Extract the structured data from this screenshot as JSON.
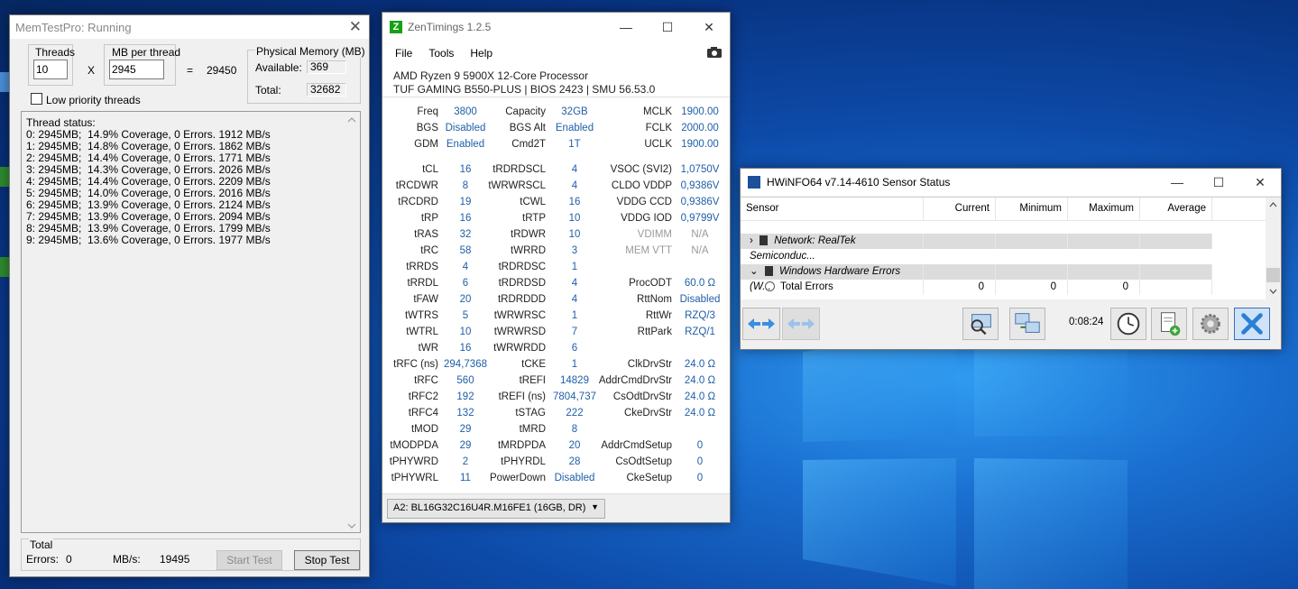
{
  "memtest": {
    "title": "MemTestPro: Running",
    "threads_label": "Threads",
    "threads_value": "10",
    "x_sign": "X",
    "mb_label": "MB per thread",
    "mb_value": "2945",
    "eq_sign": "=",
    "total_mb": "29450",
    "phys_label": "Physical Memory (MB)",
    "available_label": "Available:",
    "available_value": "369",
    "total_label": "Total:",
    "total_value": "32682",
    "low_priority_label": "Low priority threads",
    "status_lines": [
      "Thread status:",
      "0: 2945MB;  14.9% Coverage, 0 Errors. 1912 MB/s",
      "1: 2945MB;  14.8% Coverage, 0 Errors. 1862 MB/s",
      "2: 2945MB;  14.4% Coverage, 0 Errors. 1771 MB/s",
      "3: 2945MB;  14.3% Coverage, 0 Errors. 2026 MB/s",
      "4: 2945MB;  14.4% Coverage, 0 Errors. 2209 MB/s",
      "5: 2945MB;  14.0% Coverage, 0 Errors. 2016 MB/s",
      "6: 2945MB;  13.9% Coverage, 0 Errors. 2124 MB/s",
      "7: 2945MB;  13.9% Coverage, 0 Errors. 2094 MB/s",
      "8: 2945MB;  13.9% Coverage, 0 Errors. 1799 MB/s",
      "9: 2945MB;  13.6% Coverage, 0 Errors. 1977 MB/s"
    ],
    "total_group_label": "Total",
    "errors_label": "Errors:",
    "errors_value": "0",
    "mbs_label": "MB/s:",
    "mbs_value": "19495",
    "start_label": "Start Test",
    "stop_label": "Stop Test"
  },
  "zen": {
    "title": "ZenTimings 1.2.5",
    "logo_letter": "Z",
    "menu": [
      "File",
      "Tools",
      "Help"
    ],
    "cpu": "AMD Ryzen 9 5900X 12-Core Processor",
    "board": "TUF GAMING B550-PLUS | BIOS 2423 | SMU 56.53.0",
    "rows": [
      [
        "Freq",
        "3800",
        "Capacity",
        "32GB",
        "MCLK",
        "1900.00"
      ],
      [
        "BGS",
        "Disabled",
        "BGS Alt",
        "Enabled",
        "FCLK",
        "2000.00"
      ],
      [
        "GDM",
        "Enabled",
        "Cmd2T",
        "1T",
        "UCLK",
        "1900.00"
      ],
      null,
      [
        "tCL",
        "16",
        "tRDRDSCL",
        "4",
        "VSOC (SVI2)",
        "1,0750V"
      ],
      [
        "tRCDWR",
        "8",
        "tWRWRSCL",
        "4",
        "CLDO VDDP",
        "0,9386V"
      ],
      [
        "tRCDRD",
        "19",
        "tCWL",
        "16",
        "VDDG CCD",
        "0,9386V"
      ],
      [
        "tRP",
        "16",
        "tRTP",
        "10",
        "VDDG IOD",
        "0,9799V"
      ],
      [
        "tRAS",
        "32",
        "tRDWR",
        "10",
        "VDIMM",
        "N/A"
      ],
      [
        "tRC",
        "58",
        "tWRRD",
        "3",
        "MEM VTT",
        "N/A"
      ],
      [
        "tRRDS",
        "4",
        "tRDRDSC",
        "1",
        "",
        ""
      ],
      [
        "tRRDL",
        "6",
        "tRDRDSD",
        "4",
        "ProcODT",
        "60.0 Ω"
      ],
      [
        "tFAW",
        "20",
        "tRDRDDD",
        "4",
        "RttNom",
        "Disabled"
      ],
      [
        "tWTRS",
        "5",
        "tWRWRSC",
        "1",
        "RttWr",
        "RZQ/3"
      ],
      [
        "tWTRL",
        "10",
        "tWRWRSD",
        "7",
        "RttPark",
        "RZQ/1"
      ],
      [
        "tWR",
        "16",
        "tWRWRDD",
        "6",
        "",
        ""
      ],
      [
        "tRFC (ns)",
        "294,7368",
        "tCKE",
        "1",
        "ClkDrvStr",
        "24.0 Ω"
      ],
      [
        "tRFC",
        "560",
        "tREFI",
        "14829",
        "AddrCmdDrvStr",
        "24.0 Ω"
      ],
      [
        "tRFC2",
        "192",
        "tREFI (ns)",
        "7804,737",
        "CsOdtDrvStr",
        "24.0 Ω"
      ],
      [
        "tRFC4",
        "132",
        "tSTAG",
        "222",
        "CkeDrvStr",
        "24.0 Ω"
      ],
      [
        "tMOD",
        "29",
        "tMRD",
        "8",
        "",
        ""
      ],
      [
        "tMODPDA",
        "29",
        "tMRDPDA",
        "20",
        "AddrCmdSetup",
        "0"
      ],
      [
        "tPHYWRD",
        "2",
        "tPHYRDL",
        "28",
        "CsOdtSetup",
        "0"
      ],
      [
        "tPHYWRL",
        "11",
        "PowerDown",
        "Disabled",
        "CkeSetup",
        "0"
      ]
    ],
    "dimm_select": "A2: BL16G32C16U4R.M16FE1 (16GB, DR)"
  },
  "hwinfo": {
    "title": "HWiNFO64 v7.14-4610 Sensor Status",
    "columns": [
      "Sensor",
      "Current",
      "Minimum",
      "Maximum",
      "Average"
    ],
    "group1": "Network: RealTek Semiconduc...",
    "group2": "Windows Hardware Errors (W...",
    "row_label": "Total Errors",
    "row_current": "0",
    "row_minimum": "0",
    "row_maximum": "0",
    "row_average": "",
    "elapsed": "0:08:24"
  }
}
